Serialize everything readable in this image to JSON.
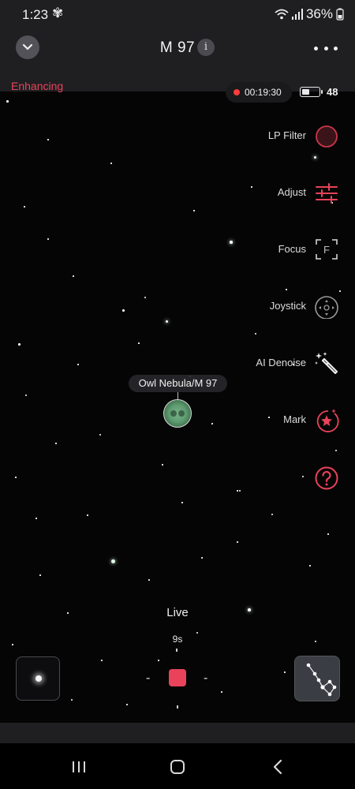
{
  "status_bar": {
    "time": "1:23",
    "battery": "36%"
  },
  "header": {
    "title": "M 97",
    "info_label": "i"
  },
  "overlay": {
    "status": "Enhancing",
    "rec_time": "00:19:30",
    "scope_battery": "48",
    "scope_battery_level": 0.45
  },
  "tools": [
    {
      "label": "LP Filter",
      "icon": "lp-filter-icon"
    },
    {
      "label": "Adjust",
      "icon": "adjust-sliders-icon"
    },
    {
      "label": "Focus",
      "icon": "focus-icon"
    },
    {
      "label": "Joystick",
      "icon": "joystick-icon"
    },
    {
      "label": "AI Denoise",
      "icon": "magic-wand-icon"
    },
    {
      "label": "Mark",
      "icon": "mark-star-icon"
    },
    {
      "label": "",
      "icon": "help-icon"
    }
  ],
  "target": {
    "label": "Owl Nebula/M 97"
  },
  "controls": {
    "mode": "Live",
    "exposure": "9s",
    "minus_left": "-",
    "minus_right": "-"
  },
  "colors": {
    "accent": "#e8435a",
    "bar": "#1f1f22",
    "sky": "#050505"
  }
}
